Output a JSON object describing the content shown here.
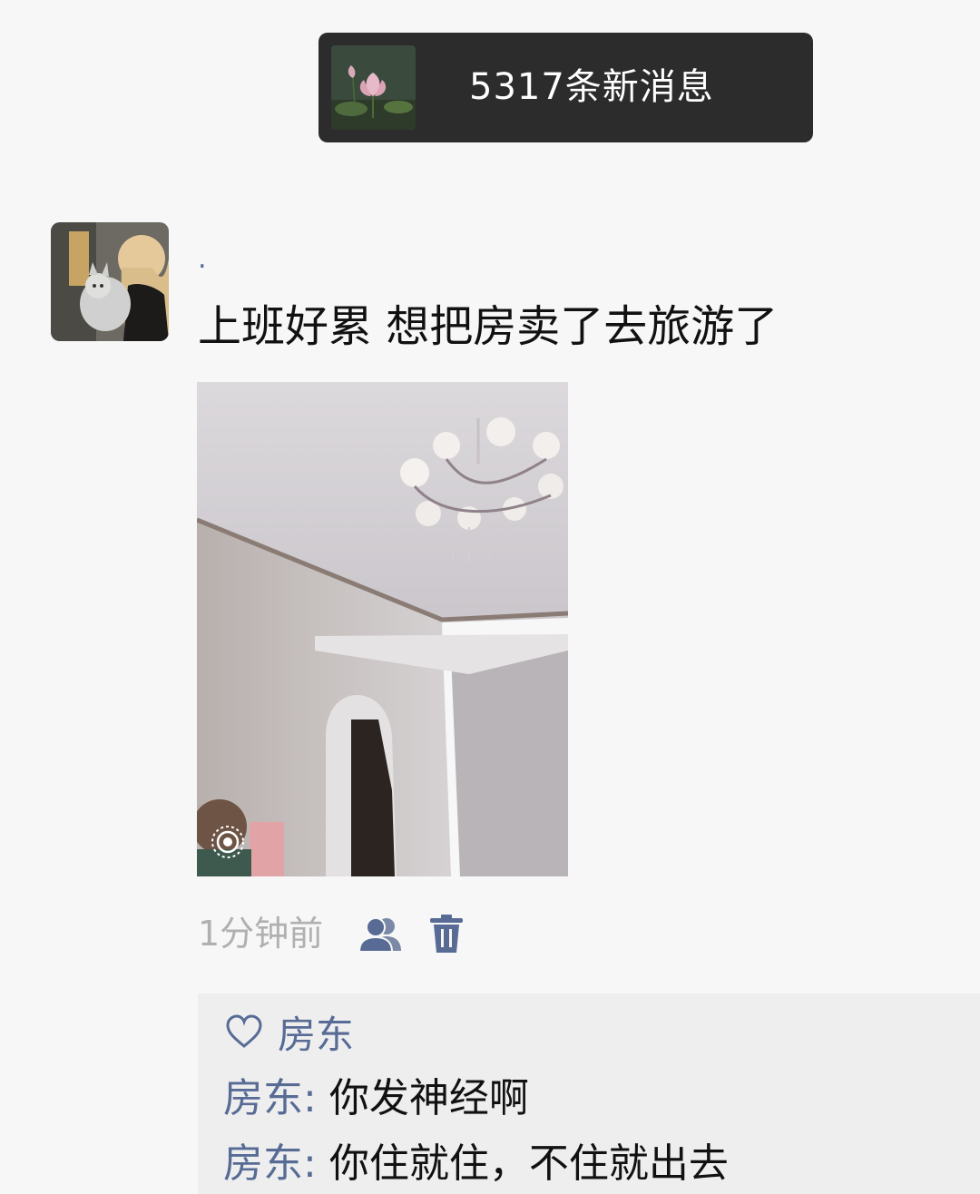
{
  "notice": {
    "text": "5317条新消息",
    "thumbnail_icon": "lotus-thumbnail"
  },
  "post": {
    "nickname": ".",
    "text": "上班好累 想把房卖了去旅游了",
    "image_icon": "live-photo-icon",
    "time": "1分钟前",
    "visibility_icon": "friends-icon",
    "delete_icon": "trash-icon"
  },
  "interactions": {
    "likes": [
      "房东"
    ],
    "comments": [
      {
        "author": "房东",
        "separator": ":",
        "text": " 你发神经啊"
      },
      {
        "author": "房东",
        "separator": ":",
        "text": " 你住就住，不住就出去"
      }
    ]
  },
  "colors": {
    "link": "#576b95",
    "notice_bg": "#2c2c2c",
    "comment_bg": "#eeeeef"
  }
}
